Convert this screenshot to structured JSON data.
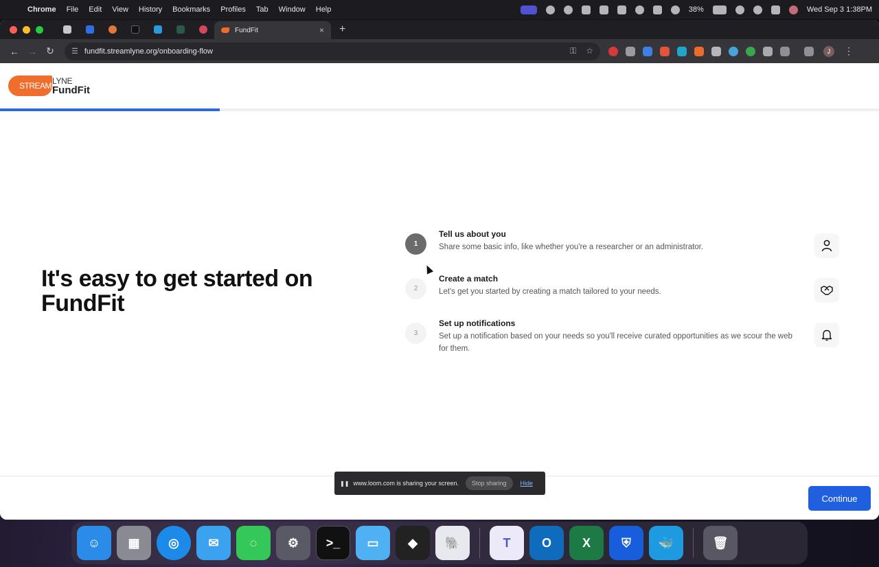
{
  "menubar": {
    "app": "Chrome",
    "items": [
      "File",
      "Edit",
      "View",
      "History",
      "Bookmarks",
      "Profiles",
      "Tab",
      "Window",
      "Help"
    ],
    "battery": "38%",
    "datetime": "Wed Sep 3  1:38PM"
  },
  "browser": {
    "active_tab_title": "FundFit",
    "url": "fundfit.streamlyne.org/onboarding-flow",
    "profile_initial": "J"
  },
  "page": {
    "logo": {
      "stream": "STREAM",
      "lyne": "LYNE",
      "product": "FundFit"
    },
    "progress": 0.25,
    "hero_title": "It's easy to get started on FundFit",
    "steps": [
      {
        "number": "1",
        "title": "Tell us about you",
        "description": "Share some basic info, like whether you're a researcher or an administrator.",
        "icon": "person-icon"
      },
      {
        "number": "2",
        "title": "Create a match",
        "description": "Let's get you started by creating a match tailored to your needs.",
        "icon": "handshake-icon"
      },
      {
        "number": "3",
        "title": "Set up notifications",
        "description": "Set up a notification based on your needs so you'll receive curated opportunities as we scour the web for them.",
        "icon": "bell-icon"
      }
    ],
    "continue_label": "Continue"
  },
  "loom_bar": {
    "message": "www.loom.com is sharing your screen.",
    "stop_label": "Stop sharing",
    "hide_label": "Hide"
  },
  "dock": {
    "apps": [
      "finder-icon",
      "launchpad-icon",
      "safari-icon",
      "mail-icon",
      "messages-icon",
      "system-settings-icon",
      "terminal-icon",
      "folder-icon",
      "unity-icon",
      "postgres-icon",
      "teams-icon",
      "outlook-icon",
      "excel-icon",
      "bitwarden-icon",
      "docker-icon",
      "trash-icon"
    ]
  }
}
